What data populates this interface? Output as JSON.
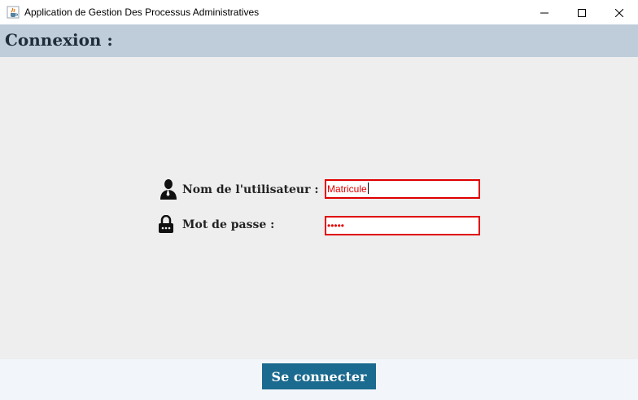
{
  "window": {
    "title": "Application de Gestion Des Processus Administratives",
    "app_icon": "java-cup-icon",
    "controls": [
      "minimize-icon",
      "maximize-icon",
      "close-icon"
    ]
  },
  "header": {
    "title": "Connexion :",
    "background": "#bfcddb"
  },
  "form": {
    "username": {
      "icon": "user-icon",
      "label": "Nom de l'utilisateur :",
      "value": "Matricule"
    },
    "password": {
      "icon": "lock-icon",
      "label": "Mot de passe :",
      "value": "•••••"
    },
    "error_color": "#e00000"
  },
  "footer": {
    "connect_label": "Se connecter",
    "button_color": "#1b6a8f"
  }
}
